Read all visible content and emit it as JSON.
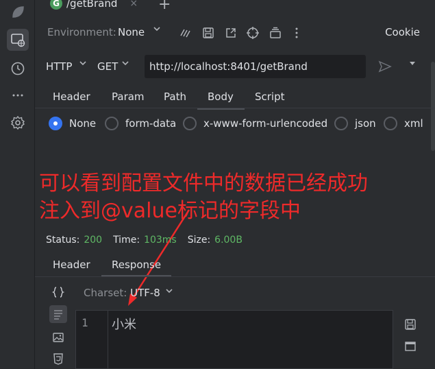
{
  "tab": {
    "badge": "G",
    "title": "/getBrand",
    "close": "×",
    "add": "+"
  },
  "env": {
    "label": "Environment:",
    "value": "None",
    "cookie": "Cookie"
  },
  "request": {
    "protocol": "HTTP",
    "method": "GET",
    "url": "http://localhost:8401/getBrand"
  },
  "request_tabs": [
    "Header",
    "Param",
    "Path",
    "Body",
    "Script"
  ],
  "active_request_tab": "Body",
  "body_types": [
    "None",
    "form-data",
    "x-www-form-urlencoded",
    "json",
    "xml"
  ],
  "selected_body_type": "None",
  "annotation": {
    "line1": "可以看到配置文件中的数据已经成功",
    "line2": "注入到@value标记的字段中",
    "color": "#ee2a2a"
  },
  "status": {
    "status_label": "Status:",
    "status_value": "200",
    "time_label": "Time:",
    "time_value": "103ms",
    "size_label": "Size:",
    "size_value": "6.00B"
  },
  "response_tabs": [
    "Header",
    "Response"
  ],
  "active_response_tab": "Response",
  "charset": {
    "label": "Charset:",
    "value": "UTF-8"
  },
  "editor": {
    "line_number": "1",
    "content": "小米"
  },
  "colors": {
    "accent": "#3574f0",
    "success": "#5fb865",
    "tab_badge": "#4a9c5d"
  }
}
